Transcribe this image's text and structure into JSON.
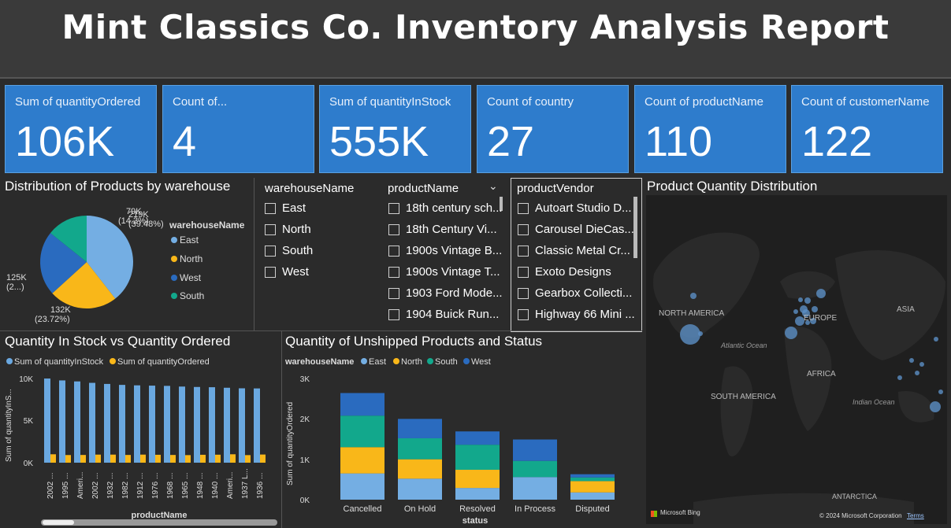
{
  "title": "Mint Classics Co. Inventory Analysis Report",
  "colors": {
    "accent": "#2e7ccc",
    "east": "#74aee3",
    "north": "#f9b719",
    "west": "#2a6bbf",
    "south": "#12a88c",
    "instock": "#6aa8e0",
    "ordered": "#f9b719"
  },
  "cards": [
    {
      "label": "Sum of quantityOrdered",
      "value": "106K"
    },
    {
      "label": "Count of...",
      "value": "4"
    },
    {
      "label": "Sum of quantityInStock",
      "value": "555K"
    },
    {
      "label": "Count of country",
      "value": "27"
    },
    {
      "label": "Count of productName",
      "value": "110"
    },
    {
      "label": "Count of customerName",
      "value": "122"
    }
  ],
  "pie": {
    "title": "Distribution of Products by warehouse",
    "legend_title": "warehouseName",
    "legend": [
      "East",
      "North",
      "West",
      "South"
    ],
    "labels": {
      "east": [
        "219K",
        "(39.48%)"
      ],
      "north": [
        "132K",
        "(23.72%)"
      ],
      "west": [
        "125K",
        "(2...)"
      ],
      "south": [
        "79K",
        "(14.3%)"
      ]
    }
  },
  "slicers": {
    "warehouse": {
      "header": "warehouseName",
      "items": [
        "East",
        "North",
        "South",
        "West"
      ]
    },
    "product": {
      "header": "productName",
      "items": [
        "18th century sch...",
        "18th Century Vi...",
        "1900s Vintage B...",
        "1900s Vintage T...",
        "1903 Ford Mode...",
        "1904 Buick Run..."
      ]
    },
    "vendor": {
      "header": "productVendor",
      "items": [
        "Autoart Studio D...",
        "Carousel DieCas...",
        "Classic Metal Cr...",
        "Exoto Designs",
        "Gearbox Collecti...",
        "Highway 66 Mini ..."
      ]
    }
  },
  "map": {
    "title": "Product Quantity Distribution",
    "labels": {
      "north_america": "NORTH AMERICA",
      "europe": "EUROPE",
      "asia": "ASIA",
      "africa": "AFRICA",
      "south_america": "SOUTH AMERICA",
      "atlantic": "Atlantic Ocean",
      "indian": "Indian Ocean",
      "antarctica": "ANTARCTICA"
    },
    "footer_brand": "Microsoft Bing",
    "footer_copy": "© 2024 Microsoft Corporation",
    "footer_terms": "Terms"
  },
  "bar_chart": {
    "title": "Quantity In Stock vs Quantity Ordered",
    "legend": [
      "Sum of quantityInStock",
      "Sum of quantityOrdered"
    ],
    "xlabel": "productName",
    "ylabel": "Sum of quantityInS...",
    "yticks": [
      "10K",
      "5K",
      "0K"
    ]
  },
  "stack_chart": {
    "title": "Quantity of Unshipped Products and Status",
    "legend_title": "warehouseName",
    "legend": [
      "East",
      "North",
      "South",
      "West"
    ],
    "xlabel": "status",
    "ylabel": "Sum of quantityOrdered",
    "yticks": [
      "3K",
      "2K",
      "1K",
      "0K"
    ]
  },
  "chart_data": [
    {
      "type": "pie",
      "title": "Distribution of Products by warehouse",
      "categories": [
        "East",
        "North",
        "West",
        "South"
      ],
      "values": [
        219,
        132,
        125,
        79
      ],
      "percent": [
        39.48,
        23.72,
        22.5,
        14.3
      ],
      "legend": "right"
    },
    {
      "type": "bar",
      "title": "Quantity In Stock vs Quantity Ordered",
      "categories": [
        "2002 ...",
        "1995 ...",
        "Ameri...",
        "2002 ...",
        "1932 ...",
        "1982 ...",
        "1912 ...",
        "1976 ...",
        "1968 ...",
        "1965 ...",
        "1948 ...",
        "1940 ...",
        "Ameri...",
        "1937 L...",
        "1936 ..."
      ],
      "xlabel": "productName",
      "ylabel": "Sum of quantityInS...",
      "ylim": [
        0,
        10500
      ],
      "series": [
        {
          "name": "Sum of quantityInStock",
          "values": [
            9997,
            9772,
            9653,
            9483,
            9354,
            9241,
            9186,
            9152,
            9123,
            9042,
            8993,
            8964,
            8900,
            8834,
            8820
          ]
        },
        {
          "name": "Sum of quantityOrdered",
          "values": [
            1000,
            910,
            920,
            960,
            960,
            920,
            960,
            940,
            920,
            900,
            940,
            950,
            1000,
            900,
            970
          ]
        }
      ]
    },
    {
      "type": "bar",
      "stacked": true,
      "title": "Quantity of Unshipped Products and Status",
      "categories": [
        "Cancelled",
        "On Hold",
        "Resolved",
        "In Process",
        "Disputed"
      ],
      "xlabel": "status",
      "ylabel": "Sum of quantityOrdered",
      "ylim": [
        0,
        3000
      ],
      "series": [
        {
          "name": "East",
          "values": [
            650,
            520,
            290,
            560,
            180
          ]
        },
        {
          "name": "North",
          "values": [
            650,
            480,
            450,
            0,
            280
          ]
        },
        {
          "name": "South",
          "values": [
            780,
            520,
            620,
            400,
            90
          ]
        },
        {
          "name": "West",
          "values": [
            560,
            480,
            330,
            530,
            80
          ]
        }
      ]
    }
  ]
}
